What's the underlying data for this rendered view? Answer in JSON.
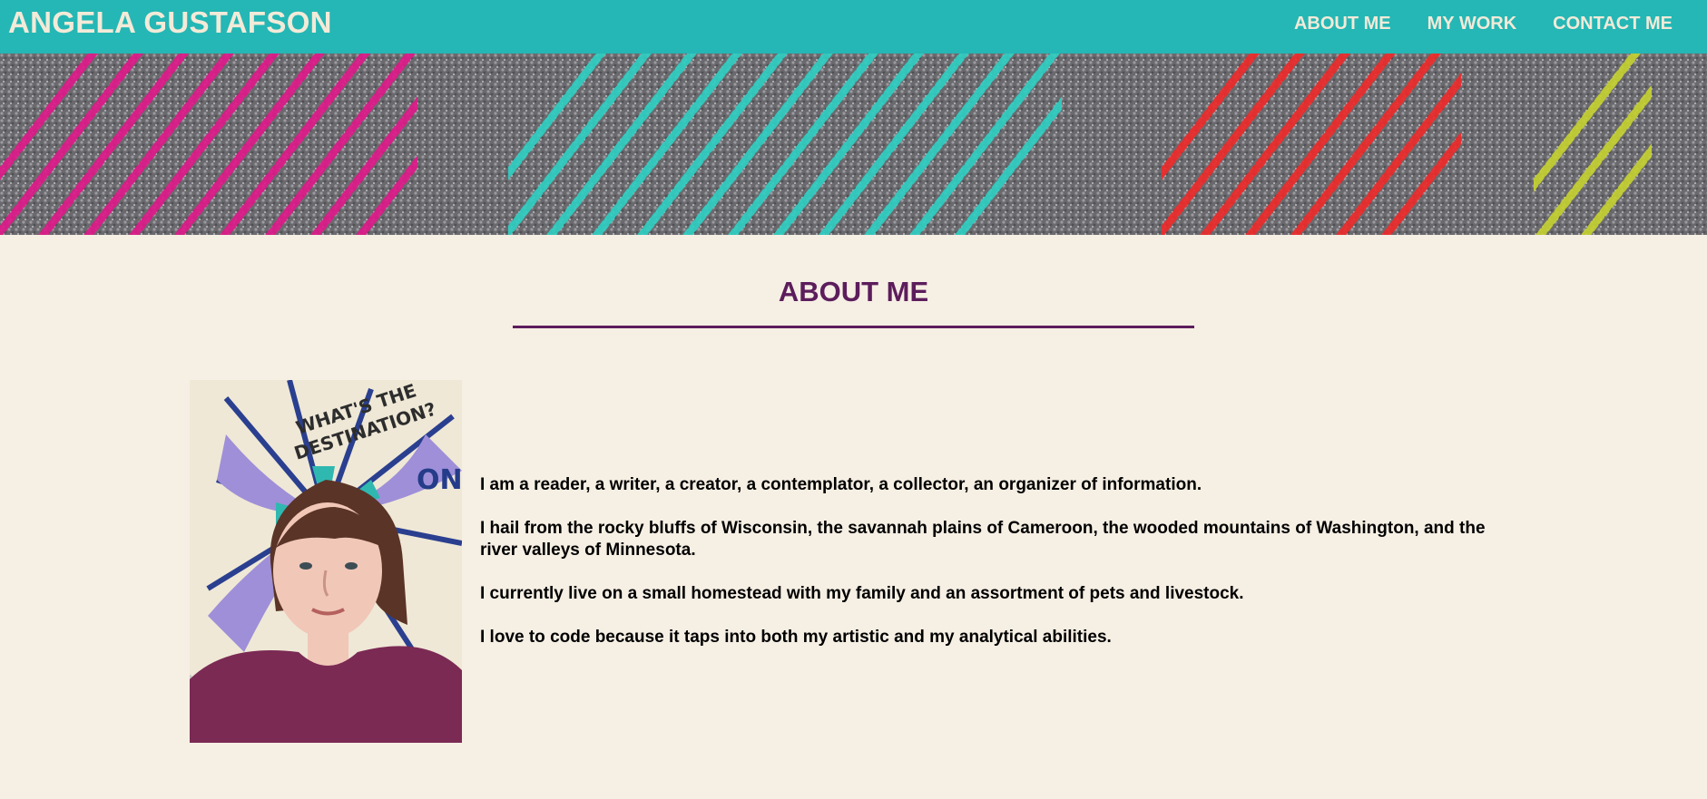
{
  "header": {
    "site_title": "ANGELA GUSTAFSON",
    "nav": [
      {
        "label": "ABOUT ME"
      },
      {
        "label": "MY WORK"
      },
      {
        "label": "CONTACT ME"
      }
    ]
  },
  "banner": {
    "image": "knitted-textile-banner",
    "stripe_colors": [
      "#e0198a",
      "#2fd0c4",
      "#ef2a2a",
      "#c7d330"
    ]
  },
  "about": {
    "title": "ABOUT ME",
    "photo": "portrait-photo",
    "paragraphs": [
      "I am a reader, a writer, a creator, a contemplator, a collector, an organizer of information.",
      "I hail from the rocky bluffs of Wisconsin, the savannah plains of Cameroon, the wooded mountains of Washington, and the river valleys of Minnesota.",
      "I currently live on a small homestead with my family and an assortment of pets and livestock.",
      "I love to code because it taps into both my artistic and my analytical abilities."
    ]
  },
  "colors": {
    "header_bg": "#24b7b5",
    "header_text": "#f3ead8",
    "page_bg": "#f6efe4",
    "accent": "#5c1d5c"
  }
}
